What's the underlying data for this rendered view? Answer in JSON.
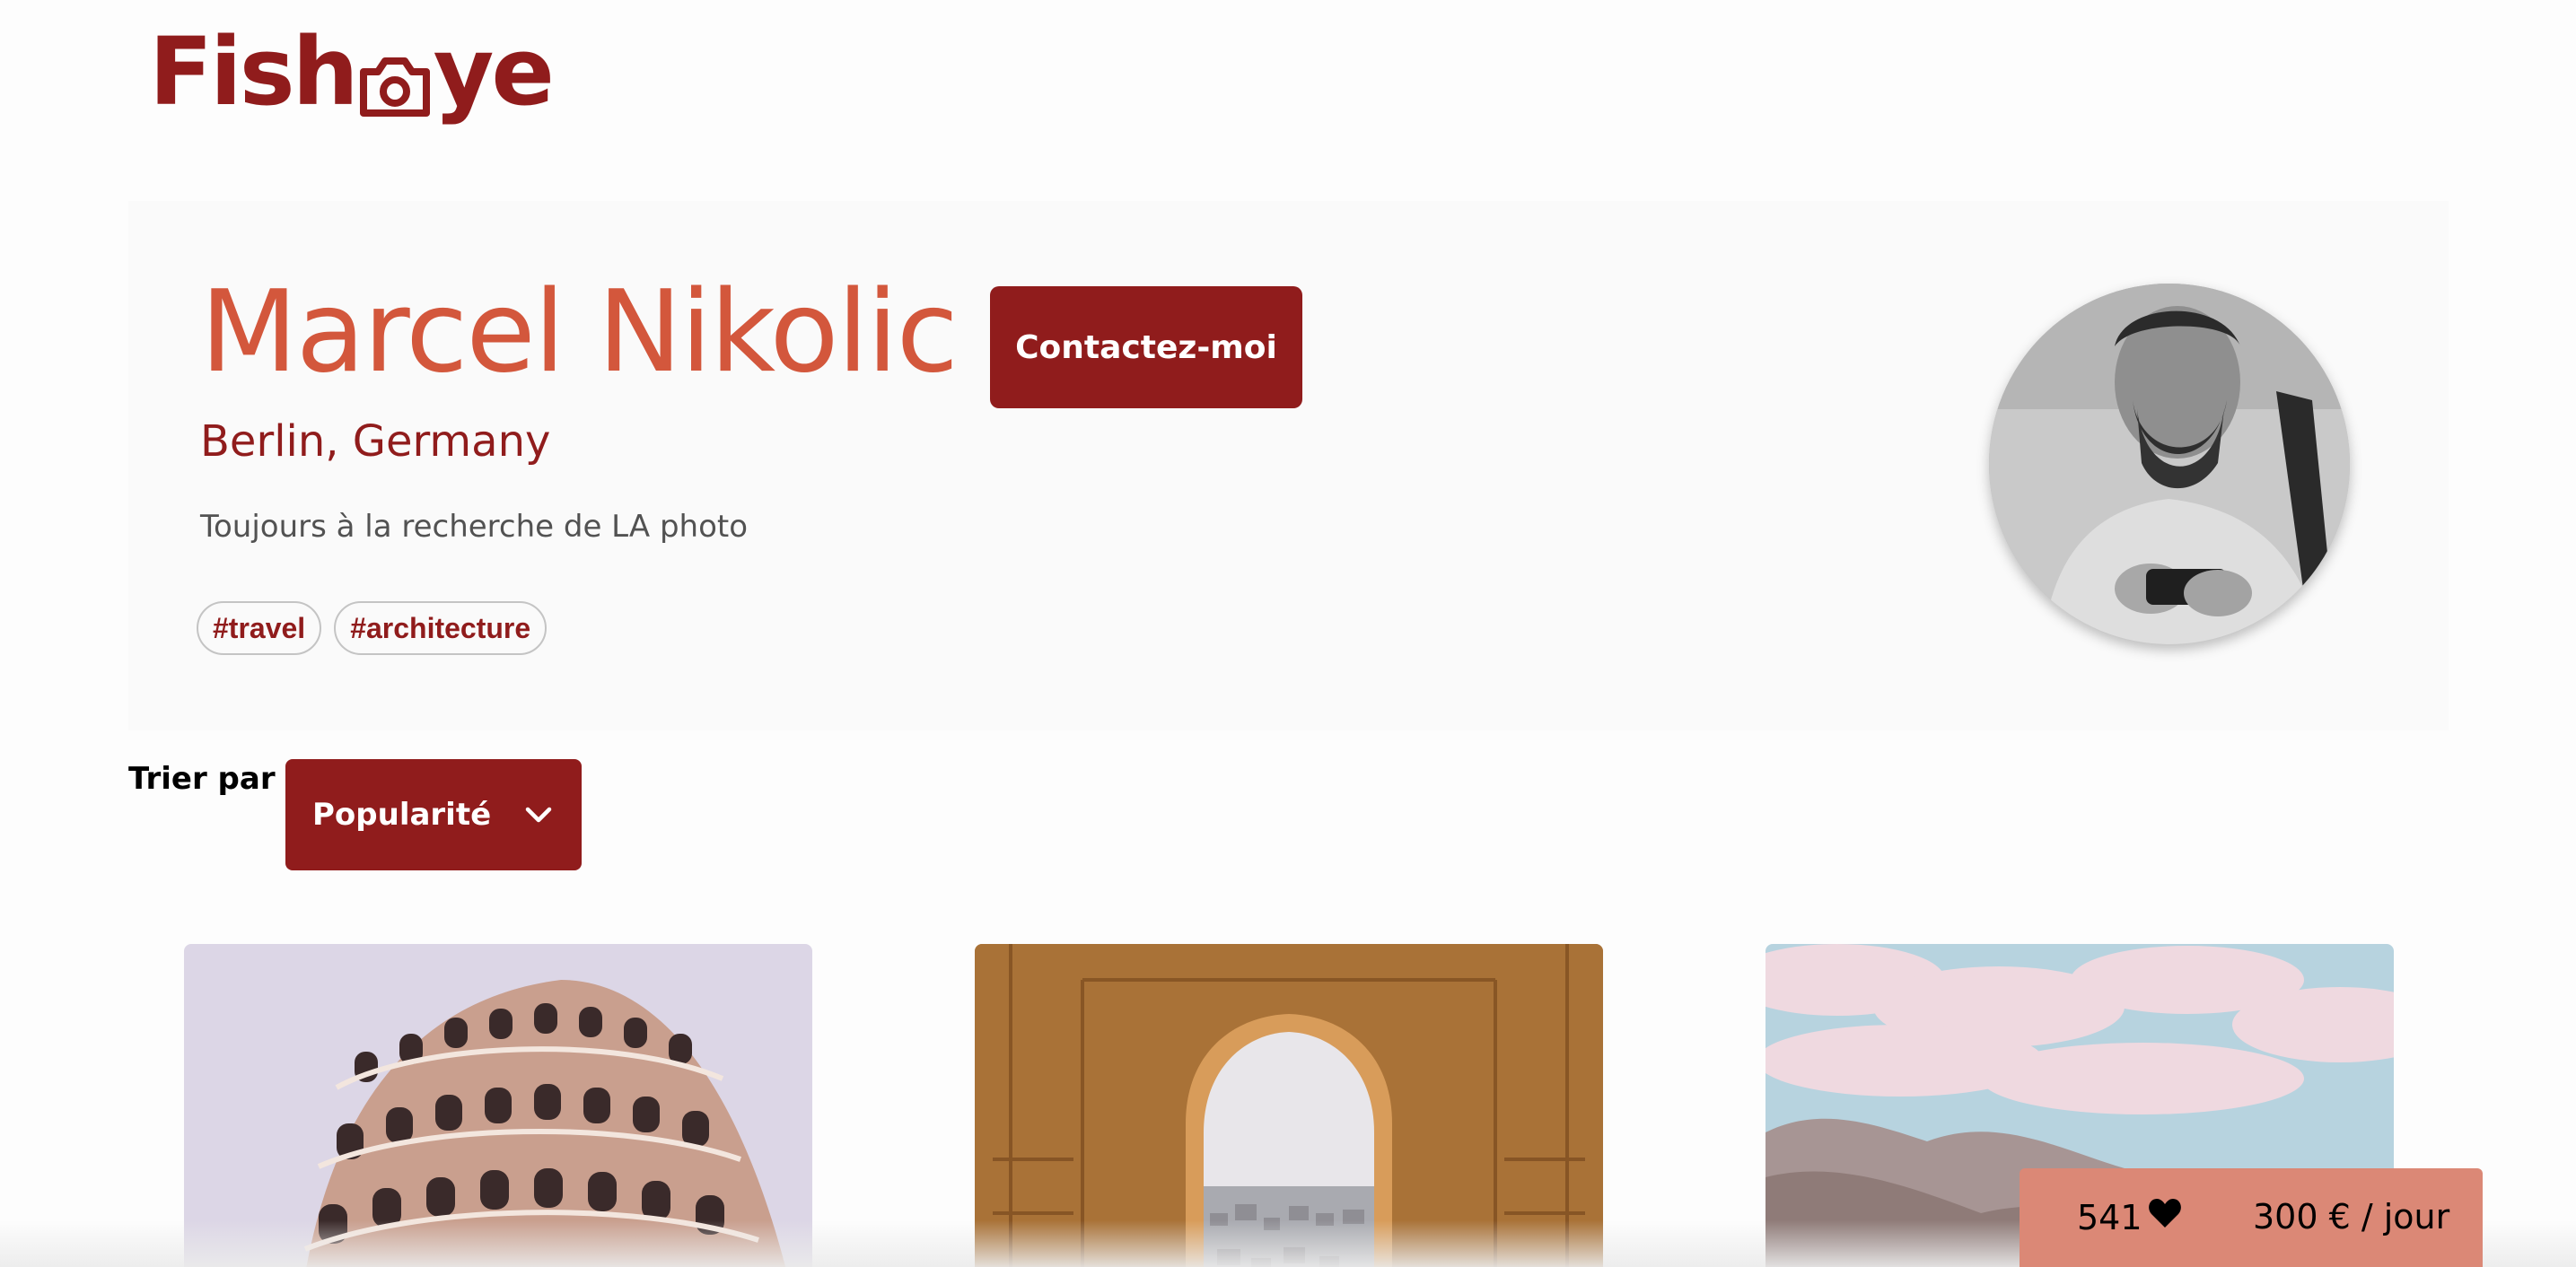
{
  "app": {
    "logo_text_left": "Fish",
    "logo_text_right": "ye",
    "logo_icon": "camera-icon"
  },
  "colors": {
    "brand": "#901c1c",
    "name_accent": "#d3573c",
    "widget_bg": "#db8876"
  },
  "photographer": {
    "name": "Marcel Nikolic",
    "location": "Berlin, Germany",
    "tagline": "Toujours à la recherche de LA photo",
    "tags": [
      "#travel",
      "#architecture"
    ],
    "contact_label": "Contactez-moi",
    "portrait_icon": "photographer-portrait"
  },
  "sort": {
    "label": "Trier par",
    "selected": "Popularité",
    "icon": "chevron-down-icon"
  },
  "gallery": {
    "items": [
      {
        "subject": "leaning-tower-photo"
      },
      {
        "subject": "moorish-arch-photo"
      },
      {
        "subject": "mountain-sky-photo"
      }
    ]
  },
  "stats": {
    "likes": "541",
    "like_icon": "heart-icon",
    "price": "300 € / jour"
  }
}
